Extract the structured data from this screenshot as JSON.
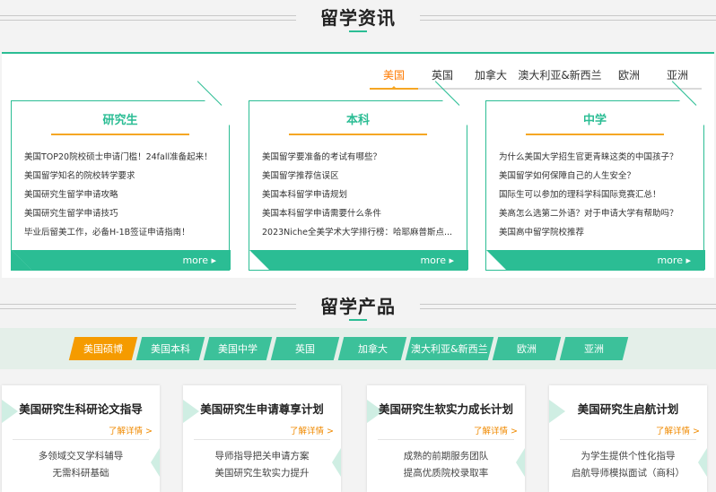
{
  "news_section": {
    "title": "留学资讯",
    "region_tabs": [
      "美国",
      "英国",
      "加拿大",
      "澳大利亚&新西兰",
      "欧洲",
      "亚洲"
    ],
    "cards": [
      {
        "title": "研究生",
        "items": [
          "美国TOP20院校硕士申请门槛！24fall准备起来！",
          "美国留学知名的院校转学要求",
          "美国研究生留学申请攻略",
          "美国研究生留学申请技巧",
          "毕业后留美工作，必备H-1B签证申请指南！"
        ],
        "more": "more"
      },
      {
        "title": "本科",
        "items": [
          "美国留学要准备的考试有哪些？",
          "美国留学推荐信误区",
          "美国本科留学申请规划",
          "美国本科留学申请需要什么条件",
          "2023Niche全美学术大学排行榜：哈耶麻普斯点..."
        ],
        "more": "more"
      },
      {
        "title": "中学",
        "items": [
          "为什么美国大学招生官更青睐这类的中国孩子？",
          "美国留学如何保障自己的人生安全？",
          "国际生可以参加的理科学科国际竞赛汇总！",
          "美高怎么选第二外语？对于申请大学有帮助吗？",
          "美国高中留学院校推荐"
        ],
        "more": "more"
      }
    ]
  },
  "product_section": {
    "title": "留学产品",
    "tabs": [
      "美国硕博",
      "美国本科",
      "美国中学",
      "英国",
      "加拿大",
      "澳大利亚&新西兰",
      "欧洲",
      "亚洲"
    ],
    "cards": [
      {
        "title": "美国研究生科研论文指导",
        "detail": "了解详情 >",
        "line1": "多领域交叉学科辅导",
        "line2": "无需科研基础"
      },
      {
        "title": "美国研究生申请尊享计划",
        "detail": "了解详情 >",
        "line1": "导师指导把关申请方案",
        "line2": "美国研究生软实力提升"
      },
      {
        "title": "美国研究生软实力成长计划",
        "detail": "了解详情 >",
        "line1": "成熟的前期服务团队",
        "line2": "提高优质院校录取率"
      },
      {
        "title": "美国研究生启航计划",
        "detail": "了解详情 >",
        "line1": "为学生提供个性化指导",
        "line2": "启航导师模拟面试（商科）"
      }
    ]
  },
  "colors": {
    "accent": "#2bbd94",
    "highlight": "#f5a623",
    "active_tab": "#f59b00"
  },
  "icons": {
    "more": "circle-arrow-right-icon",
    "detail": "chevron-right-icon"
  }
}
